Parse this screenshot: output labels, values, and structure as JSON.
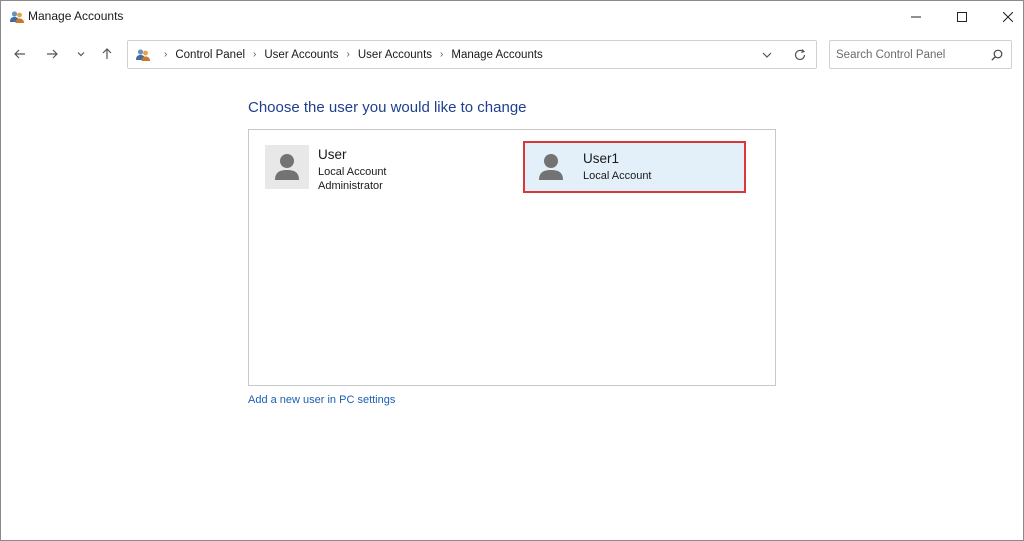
{
  "window": {
    "title": "Manage Accounts",
    "icons": {
      "app": "users-icon",
      "minimize": "minimize-icon",
      "maximize": "maximize-icon",
      "close": "close-icon"
    }
  },
  "nav": {
    "icons": {
      "back": "arrow-left-icon",
      "forward": "arrow-right-icon",
      "recent": "chevron-down-icon",
      "up": "arrow-up-icon"
    },
    "breadcrumbs": [
      "Control Panel",
      "User Accounts",
      "User Accounts",
      "Manage Accounts"
    ],
    "address_icon": "users-icon",
    "search": {
      "placeholder": "Search Control Panel",
      "value": ""
    }
  },
  "main": {
    "heading": "Choose the user you would like to change",
    "accounts": [
      {
        "name": "User",
        "lines": [
          "Local Account",
          "Administrator"
        ],
        "selected": false,
        "icon": "user-avatar-icon"
      },
      {
        "name": "User1",
        "lines": [
          "Local Account"
        ],
        "selected": true,
        "icon": "user-avatar-icon"
      }
    ],
    "add_user_link": "Add a new user in PC settings"
  },
  "colors": {
    "heading": "#1e3f8f",
    "link": "#1a5fb4",
    "selected_bg": "#e3f0fa",
    "highlight_border": "#d9383a"
  }
}
